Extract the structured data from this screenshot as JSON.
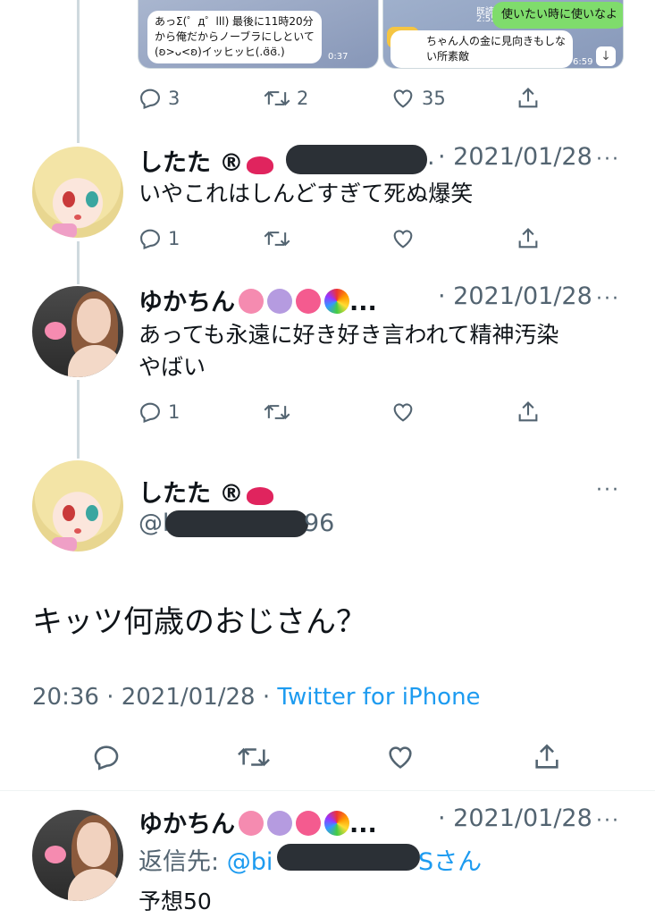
{
  "media": {
    "left_text": "あっΣ(゜д゜lll) 最後に11時20分\nから俺だからノーブラにしといて\n(ʚ>ᴗ<ʚ)イッヒッヒ(.ɞ̈ɞ̈.)",
    "left_time": "0:37",
    "right_green": "使いたい時に使いなよ",
    "right_read": "既読",
    "right_read_time": "2:55",
    "right_text": "ちゃん人の金に見向きもしな\nい所素敵",
    "right_time": "6:59"
  },
  "top_actions": {
    "replies": "3",
    "retweets": "2",
    "likes": "35"
  },
  "tweet1": {
    "name": "したた ®",
    "date_prefix": ".",
    "date": "· 2021/01/28",
    "more": "···",
    "text": "いやこれはしんどすぎて死ぬ爆笑",
    "replies": "1"
  },
  "tweet2": {
    "name": "ゆかちん",
    "ellipsis": "...",
    "date": "· 2021/01/28",
    "more": "···",
    "text_line1": "あっても永遠に好き好き言われて精神汚染",
    "text_line2": "やばい",
    "replies": "1"
  },
  "main": {
    "name": "したた ®",
    "handle_prefix": "@b",
    "handle_suffix": "96",
    "more": "···",
    "text": "キッツ何歳のおじさん？",
    "time": "20:36 · 2021/01/28 · ",
    "source": "Twitter for iPhone"
  },
  "tweet3": {
    "name": "ゆかちん",
    "ellipsis": "...",
    "date": "· 2021/01/28",
    "more": "···",
    "reply_label": "返信先: ",
    "reply_handle_prefix": "@bi",
    "reply_handle_suffix": "Sさん",
    "text": "予想50"
  },
  "icons": [
    "reply-icon",
    "retweet-icon",
    "like-icon",
    "share-icon",
    "more-icon",
    "kiss-emoji",
    "brain-emoji",
    "unicorn-emoji",
    "heart-ribbon-emoji",
    "rainbow-emoji"
  ],
  "colors": {
    "text": "#0f1419",
    "secondary": "#536471",
    "link": "#1d9bf0",
    "line": "#cfd9de",
    "redaction": "#2b3036"
  }
}
